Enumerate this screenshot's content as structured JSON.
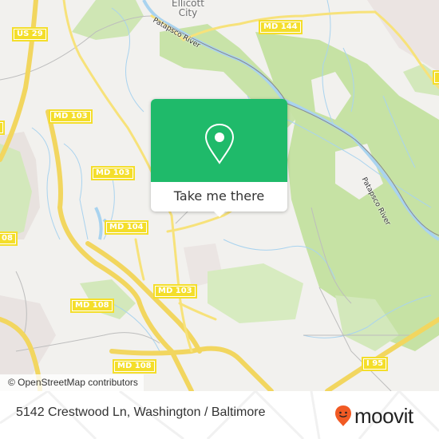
{
  "map": {
    "place_labels": {
      "ellicott_city": [
        "Ellicott",
        "City"
      ]
    },
    "river_labels": {
      "patapsco_upper": "Patapsco River",
      "patapsco_lower": "Patapsco River"
    },
    "road_shields": {
      "us29": "US 29",
      "md144": "MD 144",
      "md103_top": "MD 103",
      "md103_mid": "MD 103",
      "md104": "MD 104",
      "md103_low": "MD 103",
      "md108_mid": "MD 108",
      "md108_bottom": "MD 108",
      "md108_left_edge": "08",
      "i95": "I 95",
      "edge_left_top": "",
      "edge_right": ""
    },
    "attribution": "© OpenStreetMap contributors",
    "colors": {
      "land": "#f2f1ee",
      "park": "#c8e3a8",
      "water": "#a9d3ef",
      "road": "#f7e27a",
      "urban": "#e8e2df"
    }
  },
  "popup": {
    "button_label": "Take me there",
    "accent_color": "#1fba6a",
    "icon": "map-pin-icon"
  },
  "footer": {
    "address": "5142 Crestwood Ln, Washington / Baltimore",
    "brand": "moovit",
    "brand_color": "#f15a24"
  }
}
